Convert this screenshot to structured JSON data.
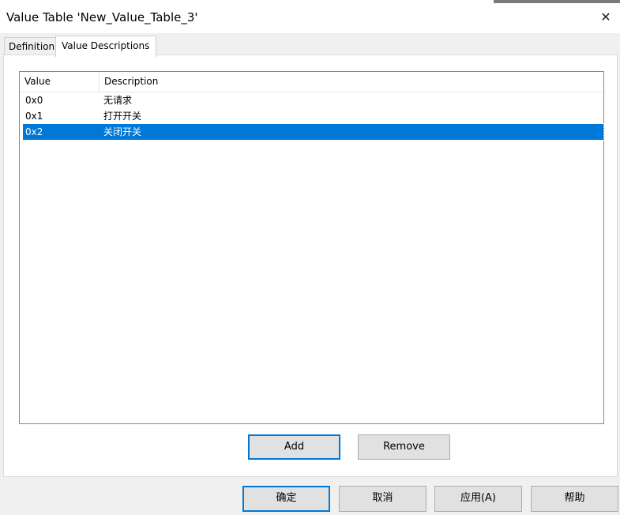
{
  "window": {
    "title": "Value Table 'New_Value_Table_3'",
    "close_glyph": "✕"
  },
  "tabs": [
    {
      "label": "Definition",
      "active": false
    },
    {
      "label": "Value Descriptions",
      "active": true
    }
  ],
  "table": {
    "columns": [
      "Value",
      "Description"
    ],
    "rows": [
      {
        "value": "0x0",
        "description": "无请求",
        "selected": false
      },
      {
        "value": "0x1",
        "description": "打开开关",
        "selected": false
      },
      {
        "value": "0x2",
        "description": "关闭开关",
        "selected": true
      }
    ]
  },
  "panel_buttons": {
    "add_label": "Add",
    "remove_label": "Remove"
  },
  "dialog_buttons": {
    "ok_label": "确定",
    "cancel_label": "取消",
    "apply_label": "应用(A)",
    "help_label": "帮助"
  },
  "colors": {
    "selection": "#0078d7",
    "default_button_border": "#0078d7"
  }
}
